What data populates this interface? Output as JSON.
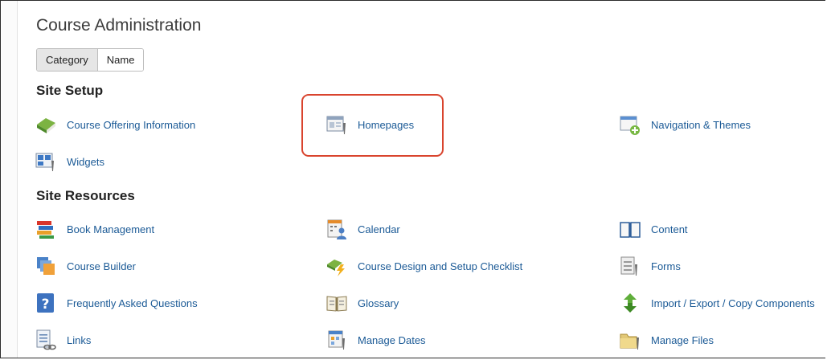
{
  "page": {
    "title": "Course Administration"
  },
  "view_toggle": {
    "category_label": "Category",
    "name_label": "Name",
    "selected": "Category"
  },
  "sections": [
    {
      "heading": "Site Setup",
      "items": [
        {
          "label": "Course Offering Information",
          "icon": "book-green-icon"
        },
        {
          "label": "Homepages",
          "icon": "homepage-wrench-icon"
        },
        {
          "label": "Navigation & Themes",
          "icon": "navigation-plus-icon"
        },
        {
          "label": "Widgets",
          "icon": "widgets-wrench-icon"
        }
      ]
    },
    {
      "heading": "Site Resources",
      "items": [
        {
          "label": "Book Management",
          "icon": "books-stack-icon"
        },
        {
          "label": "Calendar",
          "icon": "calendar-user-icon"
        },
        {
          "label": "Content",
          "icon": "open-book-icon"
        },
        {
          "label": "Course Builder",
          "icon": "layers-icon"
        },
        {
          "label": "Course Design and Setup Checklist",
          "icon": "checklist-lightning-icon"
        },
        {
          "label": "Forms",
          "icon": "forms-wrench-icon"
        },
        {
          "label": "Frequently Asked Questions",
          "icon": "question-mark-icon"
        },
        {
          "label": "Glossary",
          "icon": "glossary-book-icon"
        },
        {
          "label": "Import / Export / Copy Components",
          "icon": "import-export-arrows-icon"
        },
        {
          "label": "Links",
          "icon": "links-chain-icon"
        },
        {
          "label": "Manage Dates",
          "icon": "manage-dates-icon"
        },
        {
          "label": "Manage Files",
          "icon": "folder-wrench-icon"
        }
      ]
    }
  ],
  "colors": {
    "link": "#1b5a96",
    "highlight_border": "#d9442e"
  }
}
